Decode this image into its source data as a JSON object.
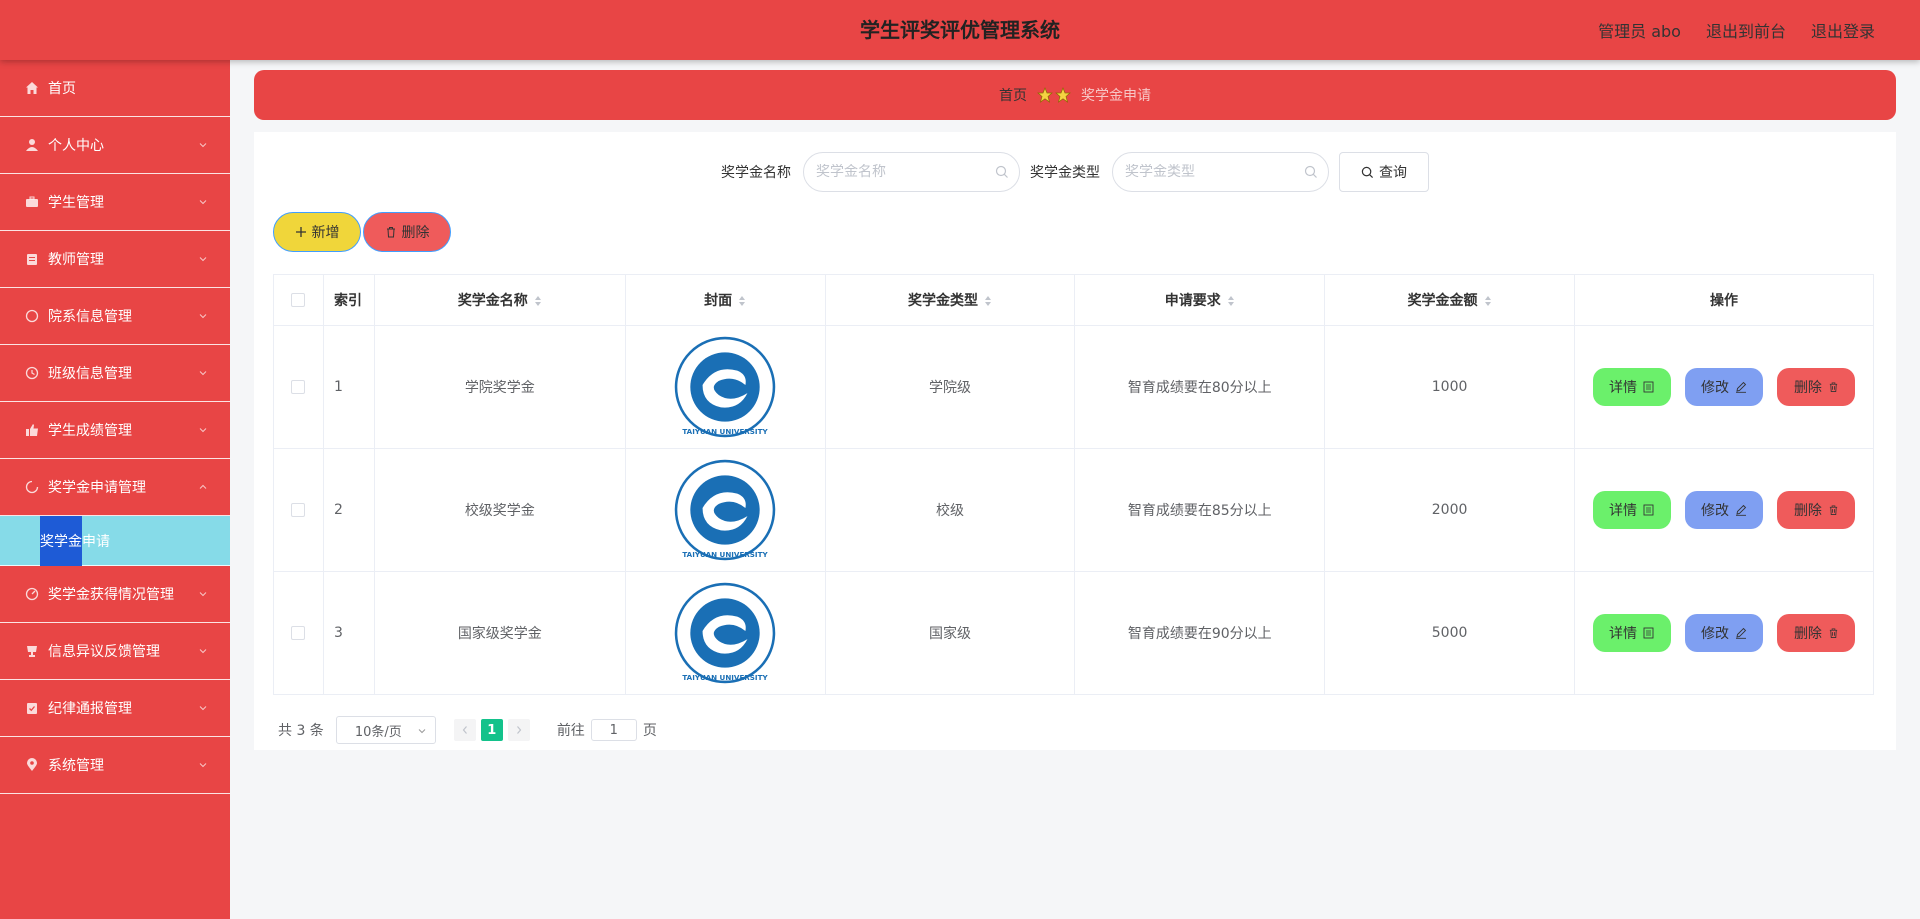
{
  "header": {
    "title": "学生评奖评优管理系统",
    "user": "管理员 abo",
    "to_front": "退出到前台",
    "logout": "退出登录"
  },
  "sidebar": {
    "items": [
      {
        "label": "首页",
        "icon": "home-icon"
      },
      {
        "label": "个人中心",
        "icon": "user-icon"
      },
      {
        "label": "学生管理",
        "icon": "briefcase-icon"
      },
      {
        "label": "教师管理",
        "icon": "clipboard-icon"
      },
      {
        "label": "院系信息管理",
        "icon": "compass-icon"
      },
      {
        "label": "班级信息管理",
        "icon": "clock-icon"
      },
      {
        "label": "学生成绩管理",
        "icon": "thumbs-up-icon"
      },
      {
        "label": "奖学金申请管理",
        "icon": "loading-icon"
      },
      {
        "label": "奖学金获得情况管理",
        "icon": "gauge-icon"
      },
      {
        "label": "信息异议反馈管理",
        "icon": "cup-icon"
      },
      {
        "label": "纪律通报管理",
        "icon": "clipboard-icon"
      },
      {
        "label": "系统管理",
        "icon": "location-icon"
      }
    ],
    "submenu": {
      "label_selected": "奖学金",
      "label_rest": "申请"
    }
  },
  "breadcrumb": {
    "home": "首页",
    "current": "奖学金申请"
  },
  "search": {
    "name_label": "奖学金名称",
    "name_placeholder": "奖学金名称",
    "type_label": "奖学金类型",
    "type_placeholder": "奖学金类型",
    "query": "查询"
  },
  "actions": {
    "add": "新增",
    "delete": "删除"
  },
  "table": {
    "headers": {
      "index": "索引",
      "name": "奖学金名称",
      "cover": "封面",
      "type": "奖学金类型",
      "requirement": "申请要求",
      "amount": "奖学金金额",
      "operation": "操作"
    },
    "rows": [
      {
        "index": "1",
        "name": "学院奖学金",
        "type": "学院级",
        "requirement": "智育成绩要在80分以上",
        "amount": "1000"
      },
      {
        "index": "2",
        "name": "校级奖学金",
        "type": "校级",
        "requirement": "智育成绩要在85分以上",
        "amount": "2000"
      },
      {
        "index": "3",
        "name": "国家级奖学金",
        "type": "国家级",
        "requirement": "智育成绩要在90分以上",
        "amount": "5000"
      }
    ],
    "op_detail": "详情",
    "op_edit": "修改",
    "op_delete": "删除",
    "logo_text": "TAIYUAN UNIVERSITY"
  },
  "pager": {
    "total": "共 3 条",
    "page_size": "10条/页",
    "current_page": "1",
    "goto_label": "前往",
    "goto_value": "1",
    "page_unit": "页"
  },
  "colors": {
    "primary": "#e84545",
    "submenu_bg": "#86dbe8",
    "add_button": "#f0d63a",
    "delete_button": "#ef5b5b",
    "detail_button": "#6bf06b",
    "edit_button": "#7f9ff2",
    "pager_active": "#13c28b"
  }
}
